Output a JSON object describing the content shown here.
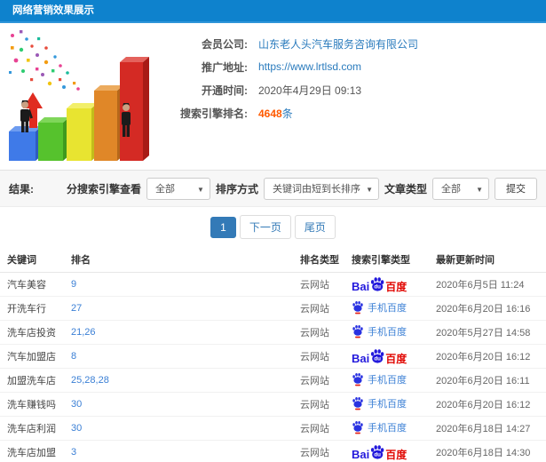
{
  "header": {
    "title": "网络营销效果展示"
  },
  "info": {
    "member_label": "会员公司:",
    "member_value": "山东老人头汽车服务咨询有限公司",
    "promo_label": "推广地址:",
    "promo_value": "https://www.lrtlsd.com",
    "open_label": "开通时间:",
    "open_value": "2020年4月29日 09:13",
    "rank_label": "搜索引擎排名:",
    "rank_count": "4648",
    "rank_unit": "条"
  },
  "filters": {
    "result_label": "结果:",
    "engine_view_label": "分搜索引擎查看",
    "engine_view_value": "全部",
    "sort_label": "排序方式",
    "sort_value": "关键词由短到长排序",
    "article_label": "文章类型",
    "article_value": "全部",
    "submit_label": "提交",
    "caret": "▼"
  },
  "pagination": {
    "current": "1",
    "next": "下一页",
    "last": "尾页"
  },
  "table": {
    "headers": [
      "关键词",
      "排名",
      "排名类型",
      "搜索引擎类型",
      "最新更新时间"
    ],
    "rows": [
      {
        "keyword": "汽车美容",
        "rank": "9",
        "rank_type": "云网站",
        "engine": "baidu",
        "updated": "2020年6月5日 11:24"
      },
      {
        "keyword": "开洗车行",
        "rank": "27",
        "rank_type": "云网站",
        "engine": "mobile",
        "updated": "2020年6月20日 16:16"
      },
      {
        "keyword": "洗车店投资",
        "rank": "21,26",
        "rank_type": "云网站",
        "engine": "mobile",
        "updated": "2020年5月27日 14:58"
      },
      {
        "keyword": "汽车加盟店",
        "rank": "8",
        "rank_type": "云网站",
        "engine": "baidu",
        "updated": "2020年6月20日 16:12"
      },
      {
        "keyword": "加盟洗车店",
        "rank": "25,28,28",
        "rank_type": "云网站",
        "engine": "mobile",
        "updated": "2020年6月20日 16:11"
      },
      {
        "keyword": "洗车赚钱吗",
        "rank": "30",
        "rank_type": "云网站",
        "engine": "mobile",
        "updated": "2020年6月20日 16:12"
      },
      {
        "keyword": "洗车店利润",
        "rank": "30",
        "rank_type": "云网站",
        "engine": "mobile",
        "updated": "2020年6月18日 14:27"
      },
      {
        "keyword": "洗车店加盟",
        "rank": "3",
        "rank_type": "云网站",
        "engine": "baidu",
        "updated": "2020年6月18日 14:30"
      }
    ]
  },
  "baidu": {
    "bai": "Bai",
    "du": "du",
    "cn": "百度",
    "mobile_label": "手机百度"
  },
  "colors": {
    "header_blue": "#0e82cd",
    "link_blue": "#2a7bbd",
    "orange": "#ff5a00",
    "baidu_blue": "#2319dc",
    "baidu_red": "#e10601"
  }
}
